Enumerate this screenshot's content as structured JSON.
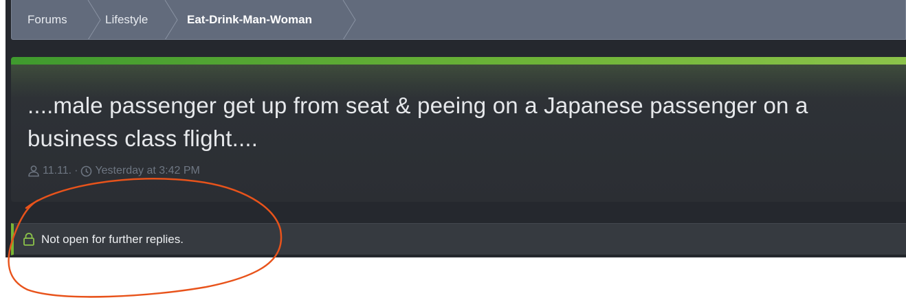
{
  "breadcrumb": {
    "items": [
      {
        "label": "Forums"
      },
      {
        "label": "Lifestyle"
      },
      {
        "label": "Eat-Drink-Man-Woman"
      }
    ]
  },
  "thread": {
    "title_line1": "....male passenger get up from seat & peeing on a Japanese passenger on a",
    "title_line2": "business class flight....",
    "author": "11.11.",
    "separator": "·",
    "date": "Yesterday at 3:42 PM"
  },
  "notice": {
    "text": "Not open for further replies."
  },
  "colors": {
    "accent_green": "#7ab534",
    "annotation_orange": "#e8531b"
  },
  "icons": {
    "author": "user-icon",
    "date": "clock-icon",
    "notice": "lock-icon"
  }
}
